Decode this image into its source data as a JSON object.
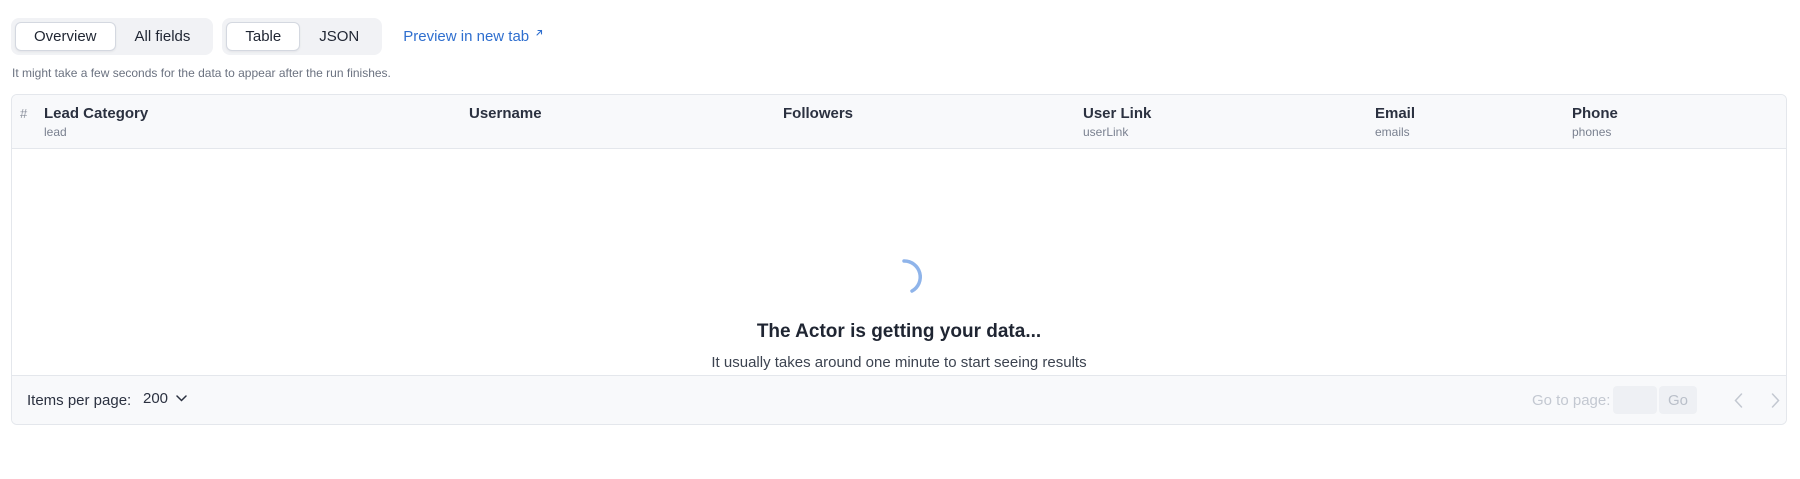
{
  "view_tabs": [
    {
      "label": "Overview",
      "active": true
    },
    {
      "label": "All fields",
      "active": false
    }
  ],
  "format_tabs": [
    {
      "label": "Table",
      "active": true
    },
    {
      "label": "JSON",
      "active": false
    }
  ],
  "preview_link": {
    "label": "Preview in new tab",
    "icon": "external-link-icon"
  },
  "hint": "It might take a few seconds for the data to appear after the run finishes.",
  "table": {
    "index_header": "#",
    "columns": [
      {
        "label": "Lead Category",
        "key": "lead"
      },
      {
        "label": "Username",
        "key": ""
      },
      {
        "label": "Followers",
        "key": ""
      },
      {
        "label": "User Link",
        "key": "userLink"
      },
      {
        "label": "Email",
        "key": "emails"
      },
      {
        "label": "Phone",
        "key": "phones"
      }
    ]
  },
  "loading": {
    "title": "The Actor is getting your data...",
    "subtitle": "It usually takes around one minute to start seeing results",
    "icon": "spinner-icon"
  },
  "footer": {
    "items_per_page_label": "Items per page:",
    "items_per_page_value": "200",
    "goto_label": "Go to page:",
    "goto_value": "",
    "go_label": "Go",
    "prev_icon": "chevron-left-icon",
    "next_icon": "chevron-right-icon"
  },
  "colors": {
    "accent": "#2f6fcf",
    "spinner": "#8fb4ea",
    "header_bg": "#f8f9fb",
    "border": "#e4e7ec"
  }
}
